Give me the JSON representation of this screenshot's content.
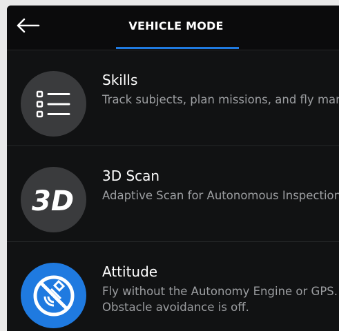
{
  "header": {
    "title": "VEHICLE MODE",
    "back_icon": "arrow-left-icon",
    "accent_color": "#1f7ae0"
  },
  "modes": [
    {
      "title": "Skills",
      "description": "Track subjects, plan missions, and fly manually.",
      "icon": "list-icon",
      "icon_bg": "#3a3b3d"
    },
    {
      "title": "3D Scan",
      "description": "Adaptive Scan for Autonomous Inspection.",
      "icon": "3d-icon",
      "icon_bg": "#3a3b3d"
    },
    {
      "title": "Attitude",
      "description": "Fly without the Autonomy Engine or GPS. Obstacle avoidance is off.",
      "icon": "no-autonomy-icon",
      "icon_bg": "#1f7ae0"
    }
  ]
}
